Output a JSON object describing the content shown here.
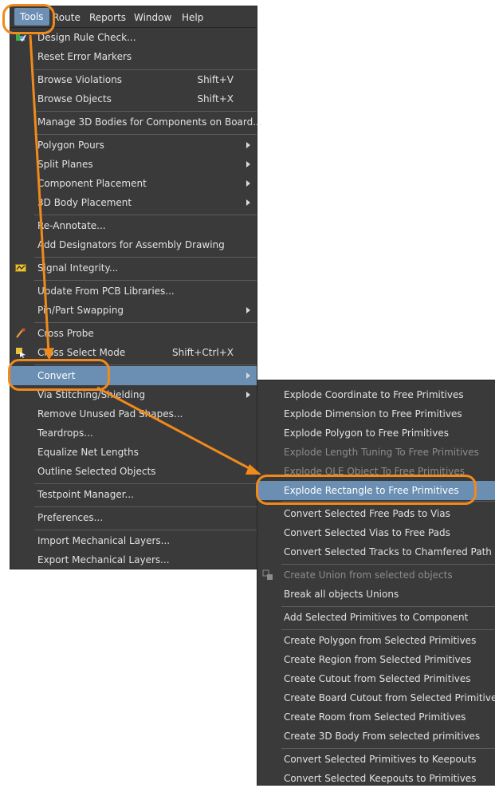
{
  "menubar": {
    "items": [
      {
        "label": "Tools",
        "active": true
      },
      {
        "label": "Route"
      },
      {
        "label": "Reports"
      },
      {
        "label": "Window"
      },
      {
        "label": "Help"
      }
    ]
  },
  "tools_menu": {
    "items": [
      {
        "label": "Design Rule Check...",
        "icon": "drc-icon"
      },
      {
        "label": "Reset Error Markers"
      },
      {
        "label": "Browse Violations",
        "shortcut": "Shift+V"
      },
      {
        "label": "Browse Objects",
        "shortcut": "Shift+X"
      },
      {
        "label": "Manage 3D Bodies for Components on Board..."
      },
      {
        "label": "Polygon Pours",
        "submenu": true
      },
      {
        "label": "Split Planes",
        "submenu": true
      },
      {
        "label": "Component Placement",
        "submenu": true
      },
      {
        "label": "3D Body Placement",
        "submenu": true
      },
      {
        "label": "Re-Annotate..."
      },
      {
        "label": "Add Designators for Assembly Drawing"
      },
      {
        "label": "Signal Integrity...",
        "icon": "signal-integrity-icon"
      },
      {
        "label": "Update From PCB Libraries..."
      },
      {
        "label": "Pin/Part Swapping",
        "submenu": true
      },
      {
        "label": "Cross Probe",
        "icon": "cross-probe-icon"
      },
      {
        "label": "Cross Select Mode",
        "shortcut": "Shift+Ctrl+X",
        "icon": "cross-select-icon"
      },
      {
        "label": "Convert",
        "submenu": true,
        "highlighted": true
      },
      {
        "label": "Via Stitching/Shielding",
        "submenu": true
      },
      {
        "label": "Remove Unused Pad Shapes..."
      },
      {
        "label": "Teardrops..."
      },
      {
        "label": "Equalize Net Lengths"
      },
      {
        "label": "Outline Selected Objects"
      },
      {
        "label": "Testpoint Manager..."
      },
      {
        "label": "Preferences..."
      },
      {
        "label": "Import Mechanical Layers..."
      },
      {
        "label": "Export Mechanical Layers..."
      }
    ]
  },
  "convert_menu": {
    "items": [
      {
        "label": "Explode Coordinate to Free Primitives"
      },
      {
        "label": "Explode Dimension to Free Primitives"
      },
      {
        "label": "Explode Polygon to Free Primitives"
      },
      {
        "label": "Explode Length Tuning To Free Primitives",
        "disabled": true
      },
      {
        "label": "Explode OLE Object To Free Primitives",
        "disabled": true
      },
      {
        "label": "Explode Rectangle to Free Primitives",
        "highlighted": true
      },
      {
        "label": "Convert Selected Free Pads to Vias"
      },
      {
        "label": "Convert Selected Vias to Free Pads"
      },
      {
        "label": "Convert Selected Tracks to Chamfered Path"
      },
      {
        "label": "Create Union from selected objects",
        "disabled": true,
        "icon": "union-icon"
      },
      {
        "label": "Break all objects Unions"
      },
      {
        "label": "Add Selected Primitives to Component"
      },
      {
        "label": "Create Polygon from Selected Primitives"
      },
      {
        "label": "Create Region from Selected Primitives"
      },
      {
        "label": "Create Cutout from Selected Primitives"
      },
      {
        "label": "Create Board Cutout from Selected Primitives"
      },
      {
        "label": "Create Room from Selected Primitives"
      },
      {
        "label": "Create 3D Body From selected primitives"
      },
      {
        "label": "Convert Selected Primitives to Keepouts"
      },
      {
        "label": "Convert Selected Keepouts to Primitives"
      }
    ]
  },
  "colors": {
    "menu_bg": "#3a3a3a",
    "highlight": "#6b8eb3",
    "callout": "#f08a1c",
    "disabled_text": "#8c8c8c"
  }
}
